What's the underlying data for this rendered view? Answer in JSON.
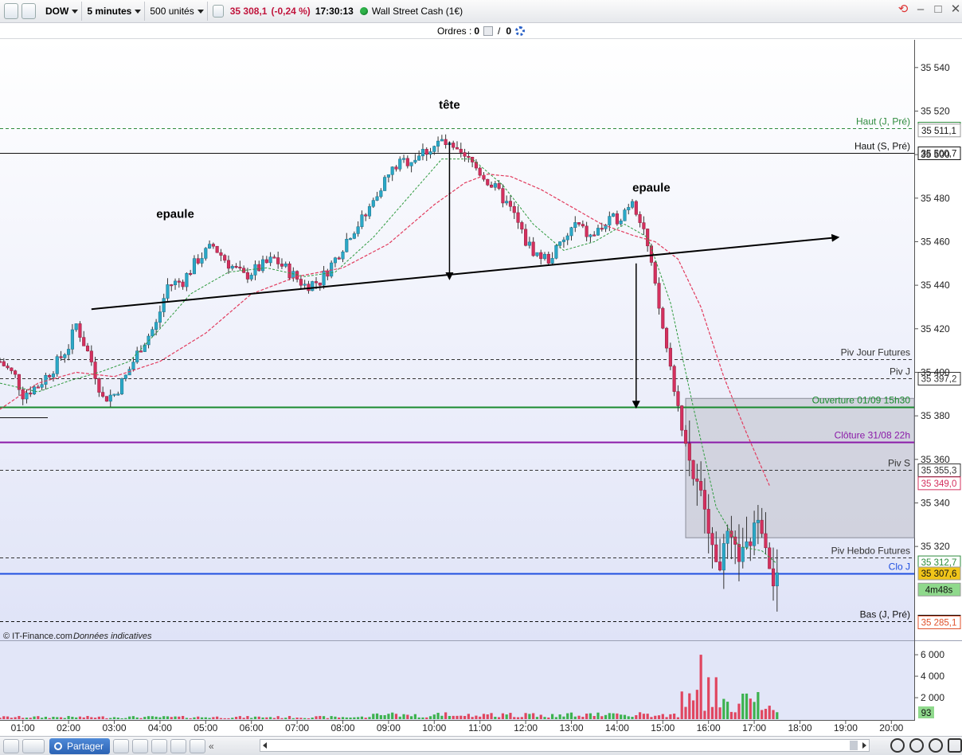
{
  "toolbar": {
    "symbol": "DOW",
    "timeframe": "5 minutes",
    "quantity": "500 unités",
    "price": "35 308,1",
    "change": "(-0,24 %)",
    "time": "17:30:13",
    "instrument": "Wall Street Cash (1€)"
  },
  "orders": {
    "label": "Ordres :",
    "count_a": "0",
    "separator": "/",
    "count_b": "0"
  },
  "watermark": {
    "source": "© IT-Finance.com",
    "note": "Données indicatives"
  },
  "bottom": {
    "share_label": "Partager"
  },
  "colors": {
    "bull": "#2aa8c7",
    "bear": "#d4305e",
    "ma_fast": "#2e9a3e",
    "ma_slow": "#e23c5e",
    "accent": "#1f4fe0"
  },
  "chart_data": {
    "type": "candlestick",
    "title": "",
    "interval": "5 minutes",
    "y_range": [
      35282,
      35552
    ],
    "x_range": [
      "00:30",
      "20:30"
    ],
    "y_ticks": [
      "35 540",
      "35 520",
      "35 500",
      "35 480",
      "35 460",
      "35 440",
      "35 420",
      "35 400",
      "35 380",
      "35 360",
      "35 340",
      "35 320"
    ],
    "x_ticks": [
      "01:00",
      "02:00",
      "03:00",
      "04:00",
      "05:00",
      "06:00",
      "07:00",
      "08:00",
      "09:00",
      "10:00",
      "11:00",
      "12:00",
      "13:00",
      "14:00",
      "15:00",
      "16:00",
      "17:00",
      "18:00",
      "19:00",
      "20:00"
    ],
    "volume_ticks": [
      "6 000",
      "4 000",
      "2 000"
    ],
    "volume_range": [
      0,
      6600
    ],
    "close_path": [
      [
        "00:30",
        35405
      ],
      [
        "00:50",
        35398
      ],
      [
        "01:00",
        35390
      ],
      [
        "01:20",
        35394
      ],
      [
        "01:40",
        35402
      ],
      [
        "02:00",
        35412
      ],
      [
        "02:10",
        35422
      ],
      [
        "02:30",
        35405
      ],
      [
        "02:45",
        35388
      ],
      [
        "03:00",
        35390
      ],
      [
        "03:15",
        35398
      ],
      [
        "03:35",
        35412
      ],
      [
        "03:55",
        35422
      ],
      [
        "04:10",
        35440
      ],
      [
        "04:30",
        35442
      ],
      [
        "04:50",
        35452
      ],
      [
        "05:10",
        35458
      ],
      [
        "05:30",
        35450
      ],
      [
        "05:50",
        35444
      ],
      [
        "06:10",
        35448
      ],
      [
        "06:30",
        35452
      ],
      [
        "06:50",
        35446
      ],
      [
        "07:10",
        35440
      ],
      [
        "07:30",
        35442
      ],
      [
        "07:50",
        35452
      ],
      [
        "08:10",
        35464
      ],
      [
        "08:30",
        35472
      ],
      [
        "08:50",
        35486
      ],
      [
        "09:10",
        35495
      ],
      [
        "09:30",
        35498
      ],
      [
        "09:50",
        35502
      ],
      [
        "10:10",
        35506
      ],
      [
        "10:30",
        35500
      ],
      [
        "10:50",
        35496
      ],
      [
        "11:10",
        35488
      ],
      [
        "11:30",
        35480
      ],
      [
        "11:45",
        35472
      ],
      [
        "12:00",
        35460
      ],
      [
        "12:15",
        35454
      ],
      [
        "12:30",
        35452
      ],
      [
        "12:50",
        35460
      ],
      [
        "13:05",
        35468
      ],
      [
        "13:25",
        35462
      ],
      [
        "13:45",
        35468
      ],
      [
        "14:05",
        35472
      ],
      [
        "14:20",
        35480
      ],
      [
        "14:35",
        35466
      ],
      [
        "14:45",
        35448
      ],
      [
        "15:00",
        35420
      ],
      [
        "15:10",
        35402
      ],
      [
        "15:25",
        35376
      ],
      [
        "15:40",
        35352
      ],
      [
        "15:55",
        35340
      ],
      [
        "16:05",
        35318
      ],
      [
        "16:15",
        35312
      ],
      [
        "16:25",
        35325
      ],
      [
        "16:40",
        35315
      ],
      [
        "16:55",
        35322
      ],
      [
        "17:05",
        35335
      ],
      [
        "17:15",
        35322
      ],
      [
        "17:25",
        35300
      ],
      [
        "17:30",
        35308
      ]
    ],
    "ma_fast": [
      [
        "00:30",
        35395
      ],
      [
        "01:20",
        35391
      ],
      [
        "02:00",
        35396
      ],
      [
        "02:40",
        35400
      ],
      [
        "03:20",
        35405
      ],
      [
        "04:00",
        35420
      ],
      [
        "04:40",
        35436
      ],
      [
        "05:30",
        35446
      ],
      [
        "06:20",
        35448
      ],
      [
        "07:10",
        35444
      ],
      [
        "07:50",
        35446
      ],
      [
        "08:40",
        35462
      ],
      [
        "09:30",
        35482
      ],
      [
        "10:10",
        35498
      ],
      [
        "10:50",
        35498
      ],
      [
        "11:30",
        35486
      ],
      [
        "12:10",
        35468
      ],
      [
        "12:50",
        35456
      ],
      [
        "13:30",
        35460
      ],
      [
        "14:10",
        35468
      ],
      [
        "14:40",
        35462
      ],
      [
        "15:10",
        35432
      ],
      [
        "15:40",
        35384
      ],
      [
        "16:10",
        35338
      ],
      [
        "16:40",
        35320
      ],
      [
        "17:10",
        35318
      ],
      [
        "17:30",
        35312
      ]
    ],
    "ma_slow": [
      [
        "00:30",
        35383
      ],
      [
        "01:20",
        35395
      ],
      [
        "02:10",
        35400
      ],
      [
        "03:00",
        35398
      ],
      [
        "04:00",
        35405
      ],
      [
        "05:00",
        35418
      ],
      [
        "06:00",
        35436
      ],
      [
        "07:00",
        35444
      ],
      [
        "08:00",
        35448
      ],
      [
        "09:00",
        35459
      ],
      [
        "10:00",
        35477
      ],
      [
        "10:40",
        35487
      ],
      [
        "11:10",
        35491
      ],
      [
        "11:40",
        35490
      ],
      [
        "12:20",
        35484
      ],
      [
        "13:00",
        35476
      ],
      [
        "13:40",
        35468
      ],
      [
        "14:20",
        35463
      ],
      [
        "14:50",
        35460
      ],
      [
        "15:20",
        35452
      ],
      [
        "15:50",
        35430
      ],
      [
        "16:20",
        35398
      ],
      [
        "16:50",
        35372
      ],
      [
        "17:20",
        35348
      ]
    ],
    "levels": [
      {
        "label": "Haut (J, Pré)",
        "value": 35512.0,
        "tag": "35 512,0",
        "color": "#2e8b3e",
        "style": "dashed"
      },
      {
        "label": "Haut (S, Pré)",
        "value": 35500.7,
        "tag": "35 500,7",
        "color": "#111111",
        "style": "solid"
      },
      {
        "label": "Piv Jour Futures",
        "value": 35406,
        "tag": "",
        "color": "#333333",
        "style": "dashed"
      },
      {
        "label": "Piv J",
        "value": 35397.2,
        "tag": "35 397,2",
        "color": "#333333",
        "style": "dashed"
      },
      {
        "label": "Ouverture 01/09 15h30",
        "value": 35384,
        "tag": "",
        "color": "#1a8a2e",
        "style": "solid"
      },
      {
        "label": "Clôture 31/08 22h",
        "value": 35368,
        "tag": "",
        "color": "#8a1aa8",
        "style": "solid"
      },
      {
        "label": "Piv S",
        "value": 35355.3,
        "tag": "35 355,3",
        "color": "#333333",
        "style": "dashed"
      },
      {
        "label": "Piv Hebdo Futures",
        "value": 35315,
        "tag": "",
        "color": "#333333",
        "style": "dashed"
      },
      {
        "label": "Clo J",
        "value": 35307.6,
        "tag": "",
        "color": "#1f4fe0",
        "style": "solid"
      },
      {
        "label": "Bas (J, Pré)",
        "value": 35285.6,
        "tag": "35 285,6",
        "color": "#111111",
        "style": "dashed"
      }
    ],
    "price_tags": [
      {
        "text": "35 511,1",
        "value": 35511.1,
        "bg": "#ffffff",
        "fg": "#111111"
      },
      {
        "text": "35 349,0",
        "value": 35349.0,
        "bg": "#ffffff",
        "fg": "#d4305e"
      },
      {
        "text": "35 312,7",
        "value": 35312.7,
        "bg": "#ffffff",
        "fg": "#2e8b3e"
      },
      {
        "text": "35 307,6",
        "value": 35307.6,
        "bg": "#f0c419",
        "fg": "#111111"
      },
      {
        "text": "4m48s",
        "value": 35300.2,
        "bg": "#8fd98c",
        "fg": "#111111"
      },
      {
        "text": "35 285,1",
        "value": 35285.1,
        "bg": "#ffffff",
        "fg": "#e0522b"
      }
    ],
    "volume_tag": "93",
    "gap_zone": {
      "from_time": "15:30",
      "to_time": "20:30",
      "top": 35388,
      "bottom": 35324
    },
    "annotations": [
      {
        "text": "tête",
        "time": "10:20",
        "value": 35521
      },
      {
        "text": "epaule",
        "time": "04:20",
        "value": 35471
      },
      {
        "text": "epaule",
        "time": "14:45",
        "value": 35483
      }
    ],
    "neckline": {
      "from": [
        "02:30",
        35429
      ],
      "to": [
        "18:50",
        35462
      ]
    },
    "arrows": [
      {
        "from": [
          "10:20",
          35506
        ],
        "to": [
          "10:20",
          35443
        ]
      },
      {
        "from": [
          "14:25",
          35450
        ],
        "to": [
          "14:25",
          35384
        ]
      }
    ]
  }
}
